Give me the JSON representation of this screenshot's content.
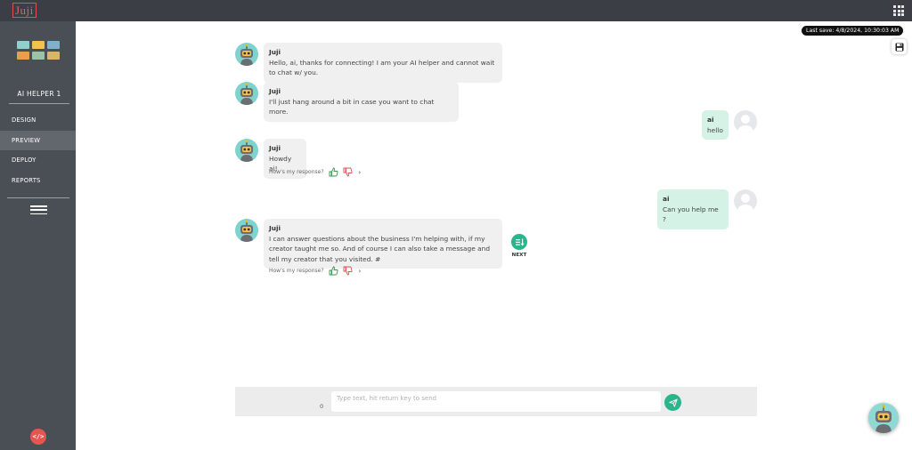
{
  "app": {
    "logo": "Juji",
    "last_save": "Last save: 4/8/2024, 10:30:03 AM"
  },
  "sidebar": {
    "agent_name": "AI HELPER 1",
    "thumb_colors": [
      "#8fd0cf",
      "#f2c14e",
      "#7fb2c9",
      "#e8a04a",
      "#9dc2a6",
      "#d9b46c"
    ],
    "items": [
      {
        "label": "DESIGN"
      },
      {
        "label": "PREVIEW"
      },
      {
        "label": "DEPLOY"
      },
      {
        "label": "REPORTS"
      }
    ]
  },
  "chat": {
    "messages": [
      {
        "role": "bot",
        "sender": "Juji",
        "text": "Hello, ai, thanks for connecting! I am your AI helper and cannot wait to chat w/ you."
      },
      {
        "role": "bot",
        "sender": "Juji",
        "text": "I'll just hang around a bit in case you want to chat more."
      },
      {
        "role": "user",
        "sender": "ai",
        "text": "hello"
      },
      {
        "role": "bot",
        "sender": "Juji",
        "text": "Howdy ai!"
      },
      {
        "role": "user",
        "sender": "ai",
        "text": "Can you help me ?"
      },
      {
        "role": "bot",
        "sender": "Juji",
        "text": "I can answer questions about the business I'm helping with, if my creator taught me so. And of course I can also take a message and tell my creator that you visited. #"
      }
    ],
    "feedback_prompt": "How's my response?",
    "next_label": "NEXT"
  },
  "input": {
    "placeholder": "Type text, hit return key to send",
    "value": "",
    "char_count": "0"
  },
  "colors": {
    "topbar": "#3b3f45",
    "sidebar": "#4a4e55",
    "accent_green": "#2bb58a",
    "user_bubble": "#d4f2e6",
    "bot_bubble": "#f0f0f0",
    "code_button": "#e8554e"
  },
  "icons": {
    "apps": "grid-icon",
    "save": "floppy-disk-icon",
    "next": "list-down-arrow-icon",
    "send": "paper-plane-icon",
    "code": "code-icon",
    "menu": "hamburger-icon"
  }
}
